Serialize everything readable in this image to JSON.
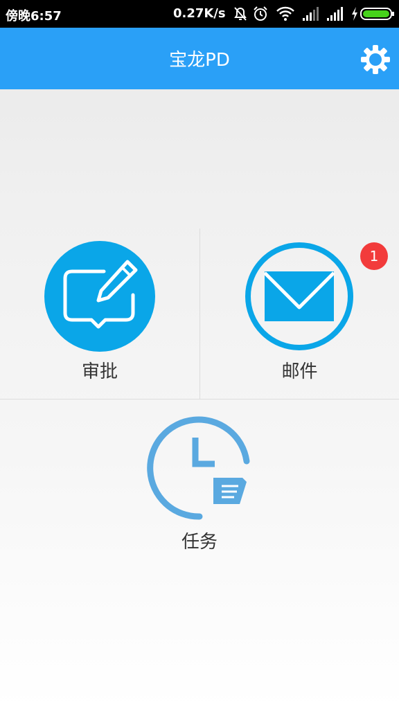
{
  "status_bar": {
    "time": "傍晚6:57",
    "network_speed": "0.27K/s",
    "icons": [
      "mute-bell-icon",
      "alarm-clock-icon",
      "wifi-icon",
      "signal-icon",
      "signal-icon",
      "charging-icon",
      "battery-icon"
    ]
  },
  "header": {
    "title": "宝龙PD",
    "settings_icon": "gear-icon"
  },
  "tiles": [
    {
      "label": "审批",
      "icon": "approval-edit-icon"
    },
    {
      "label": "邮件",
      "icon": "mail-envelope-icon",
      "badge": "1"
    },
    {
      "label": "任务",
      "icon": "task-clock-icon"
    }
  ],
  "colors": {
    "header": "#2aa0f7",
    "icon_blue": "#0aa6e8",
    "task_blue": "#5aa9e0",
    "badge_red": "#f23b3b"
  }
}
